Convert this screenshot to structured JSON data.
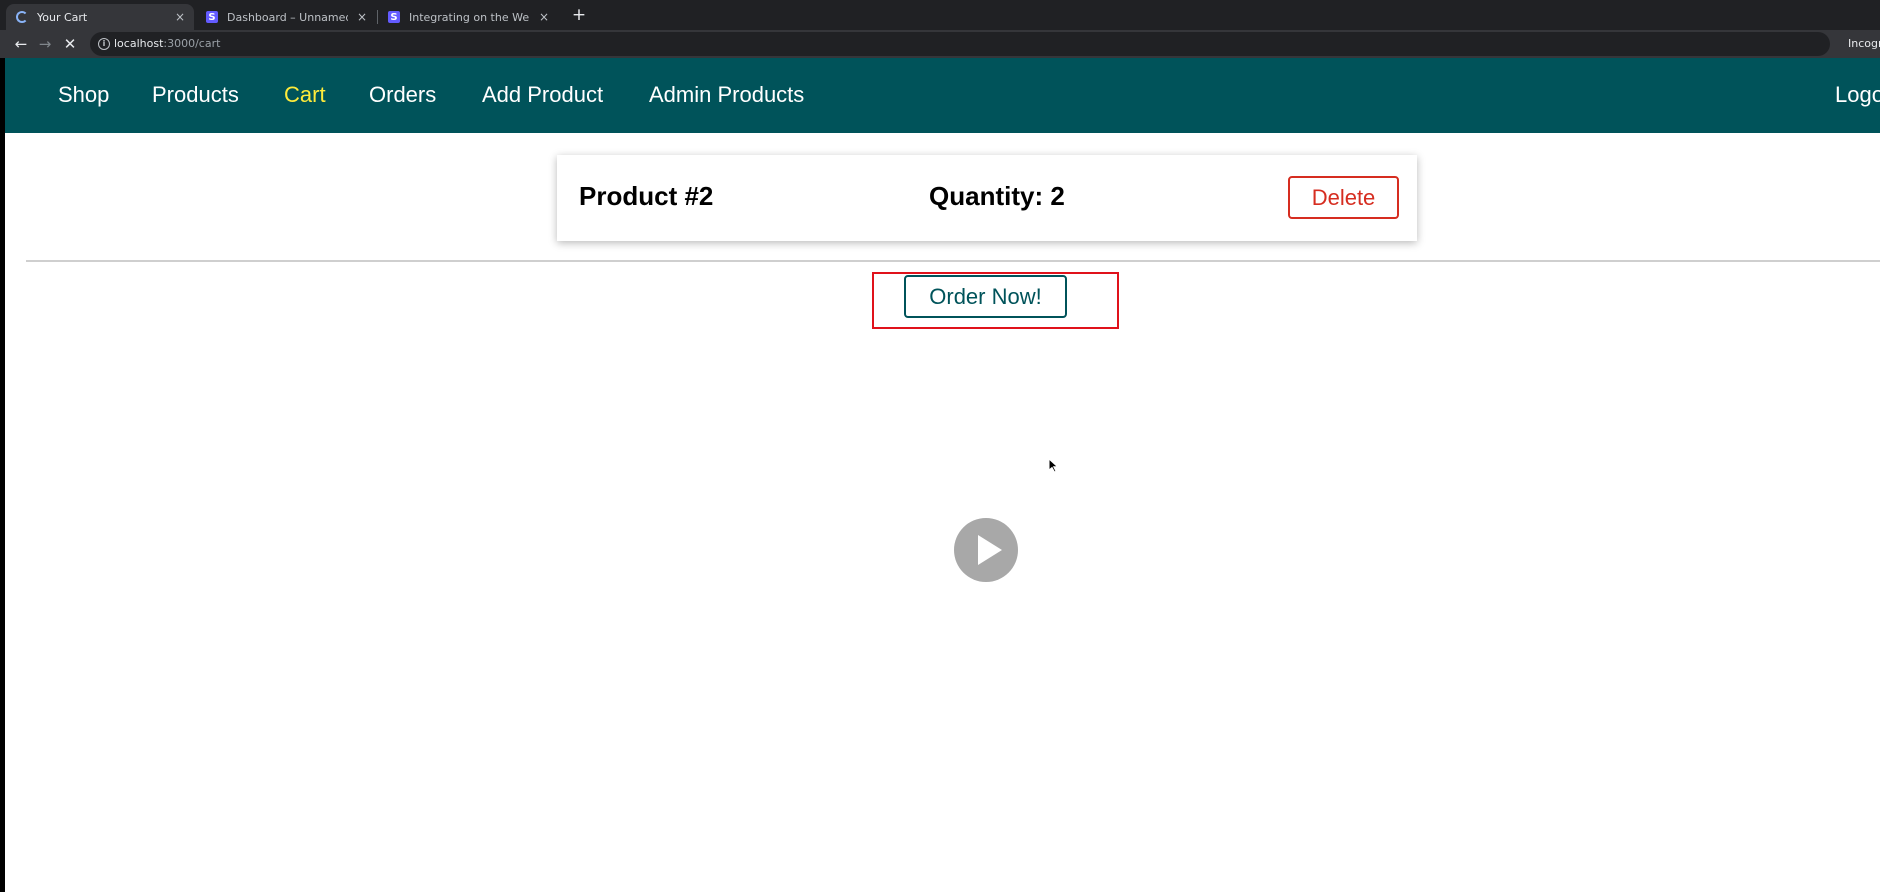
{
  "browser": {
    "tabs": [
      {
        "title": "Your Cart",
        "favicon": "loading-spinner-icon",
        "active": true
      },
      {
        "title": "Dashboard – Unnamed account",
        "favicon": "stripe-icon",
        "active": false
      },
      {
        "title": "Integrating on the Web | Stripe",
        "favicon": "stripe-icon",
        "active": false
      }
    ],
    "favicon_letter": "S",
    "new_tab_label": "+",
    "close_label": "×",
    "url_host": "localhost",
    "url_rest": ":3000/cart",
    "incognito_label": "Incognito"
  },
  "nav": {
    "items": [
      {
        "label": "Shop",
        "active": false
      },
      {
        "label": "Products",
        "active": false
      },
      {
        "label": "Cart",
        "active": true
      },
      {
        "label": "Orders",
        "active": false
      },
      {
        "label": "Add Product",
        "active": false
      },
      {
        "label": "Admin Products",
        "active": false
      }
    ],
    "logout_label": "Logout"
  },
  "cart": {
    "items": [
      {
        "title": "Product #2",
        "quantity_text": "Quantity: 2",
        "delete_label": "Delete"
      }
    ],
    "order_button_label": "Order Now!"
  },
  "colors": {
    "header_bg": "#00535a",
    "active_nav": "#ffeb3b",
    "danger": "#d62d20",
    "highlight": "#e0121b"
  },
  "overlay": {
    "play_icon": "play-icon",
    "cursor_icon": "mouse-cursor-icon"
  }
}
